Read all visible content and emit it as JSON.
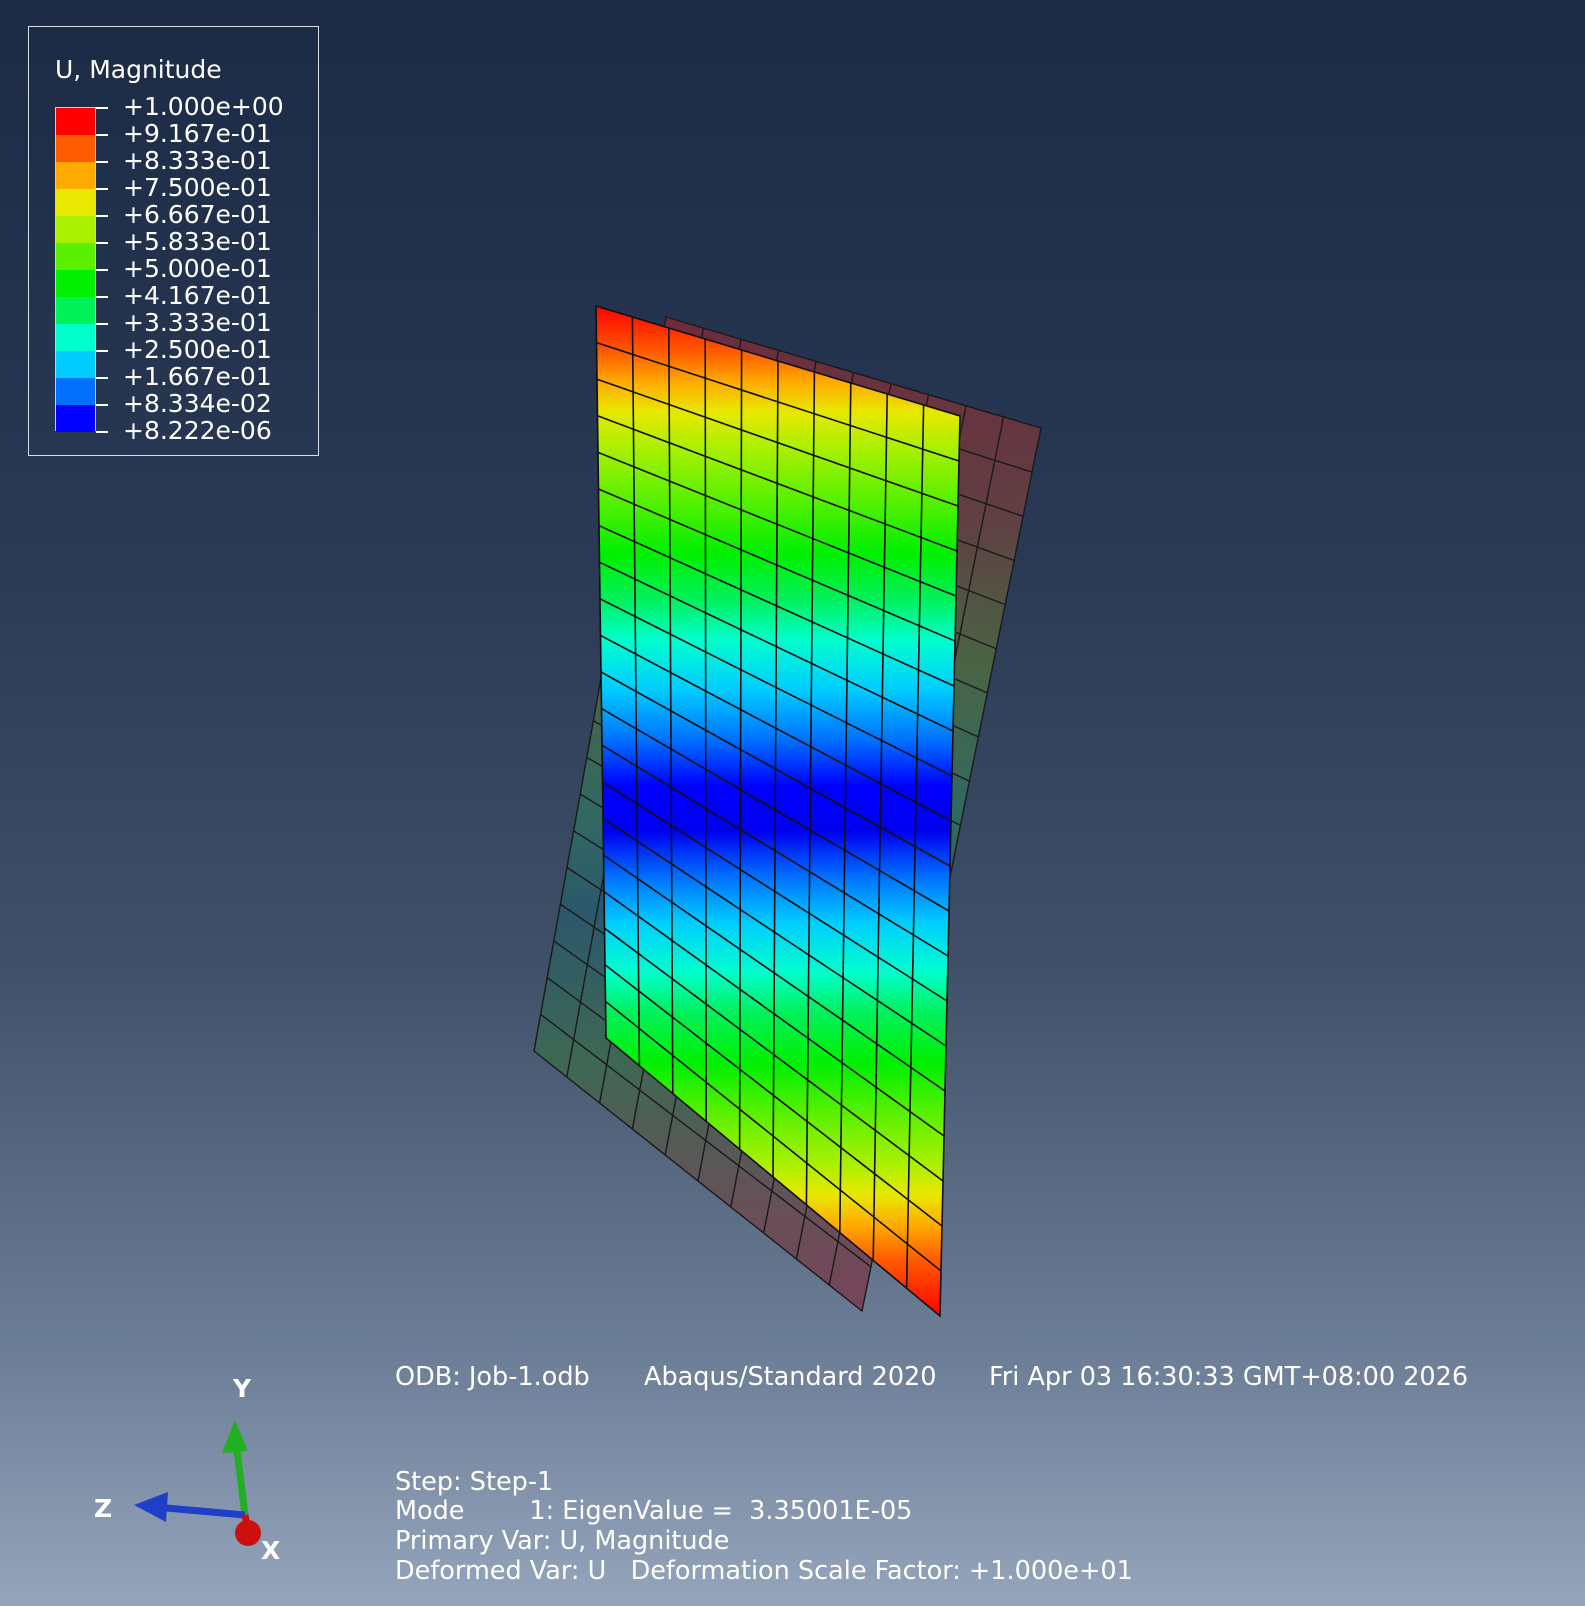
{
  "legend": {
    "title": "U, Magnitude",
    "entries": [
      {
        "label": "+1.000e+00",
        "color": "#ff0000"
      },
      {
        "label": "+9.167e-01",
        "color": "#ff5a00"
      },
      {
        "label": "+8.333e-01",
        "color": "#ffaa00"
      },
      {
        "label": "+7.500e-01",
        "color": "#e8e800"
      },
      {
        "label": "+6.667e-01",
        "color": "#aaf000"
      },
      {
        "label": "+5.833e-01",
        "color": "#5af000"
      },
      {
        "label": "+5.000e-01",
        "color": "#00f000"
      },
      {
        "label": "+4.167e-01",
        "color": "#00f05a"
      },
      {
        "label": "+3.333e-01",
        "color": "#00ffcc"
      },
      {
        "label": "+2.500e-01",
        "color": "#00ccff"
      },
      {
        "label": "+1.667e-01",
        "color": "#0070ff"
      },
      {
        "label": "+8.334e-02",
        "color": "#0000ff"
      },
      {
        "label": "+8.222e-06"
      }
    ]
  },
  "info": {
    "odb": "ODB: Job-1.odb",
    "solver": "Abaqus/Standard 2020",
    "datetime": "Fri Apr 03 16:30:33 GMT+08:00 2026",
    "step": "Step: Step-1",
    "mode": "Mode        1: EigenValue =  3.35001E-05",
    "primary_var": "Primary Var: U, Magnitude",
    "deformed_var": "Deformed Var: U   Deformation Scale Factor: +1.000e+01"
  },
  "triad": {
    "y_label": "Y",
    "z_label": "Z",
    "x_label": "X",
    "y_color": "#22b022",
    "z_color": "#1f3fc8",
    "x_color": "#cc1010"
  }
}
